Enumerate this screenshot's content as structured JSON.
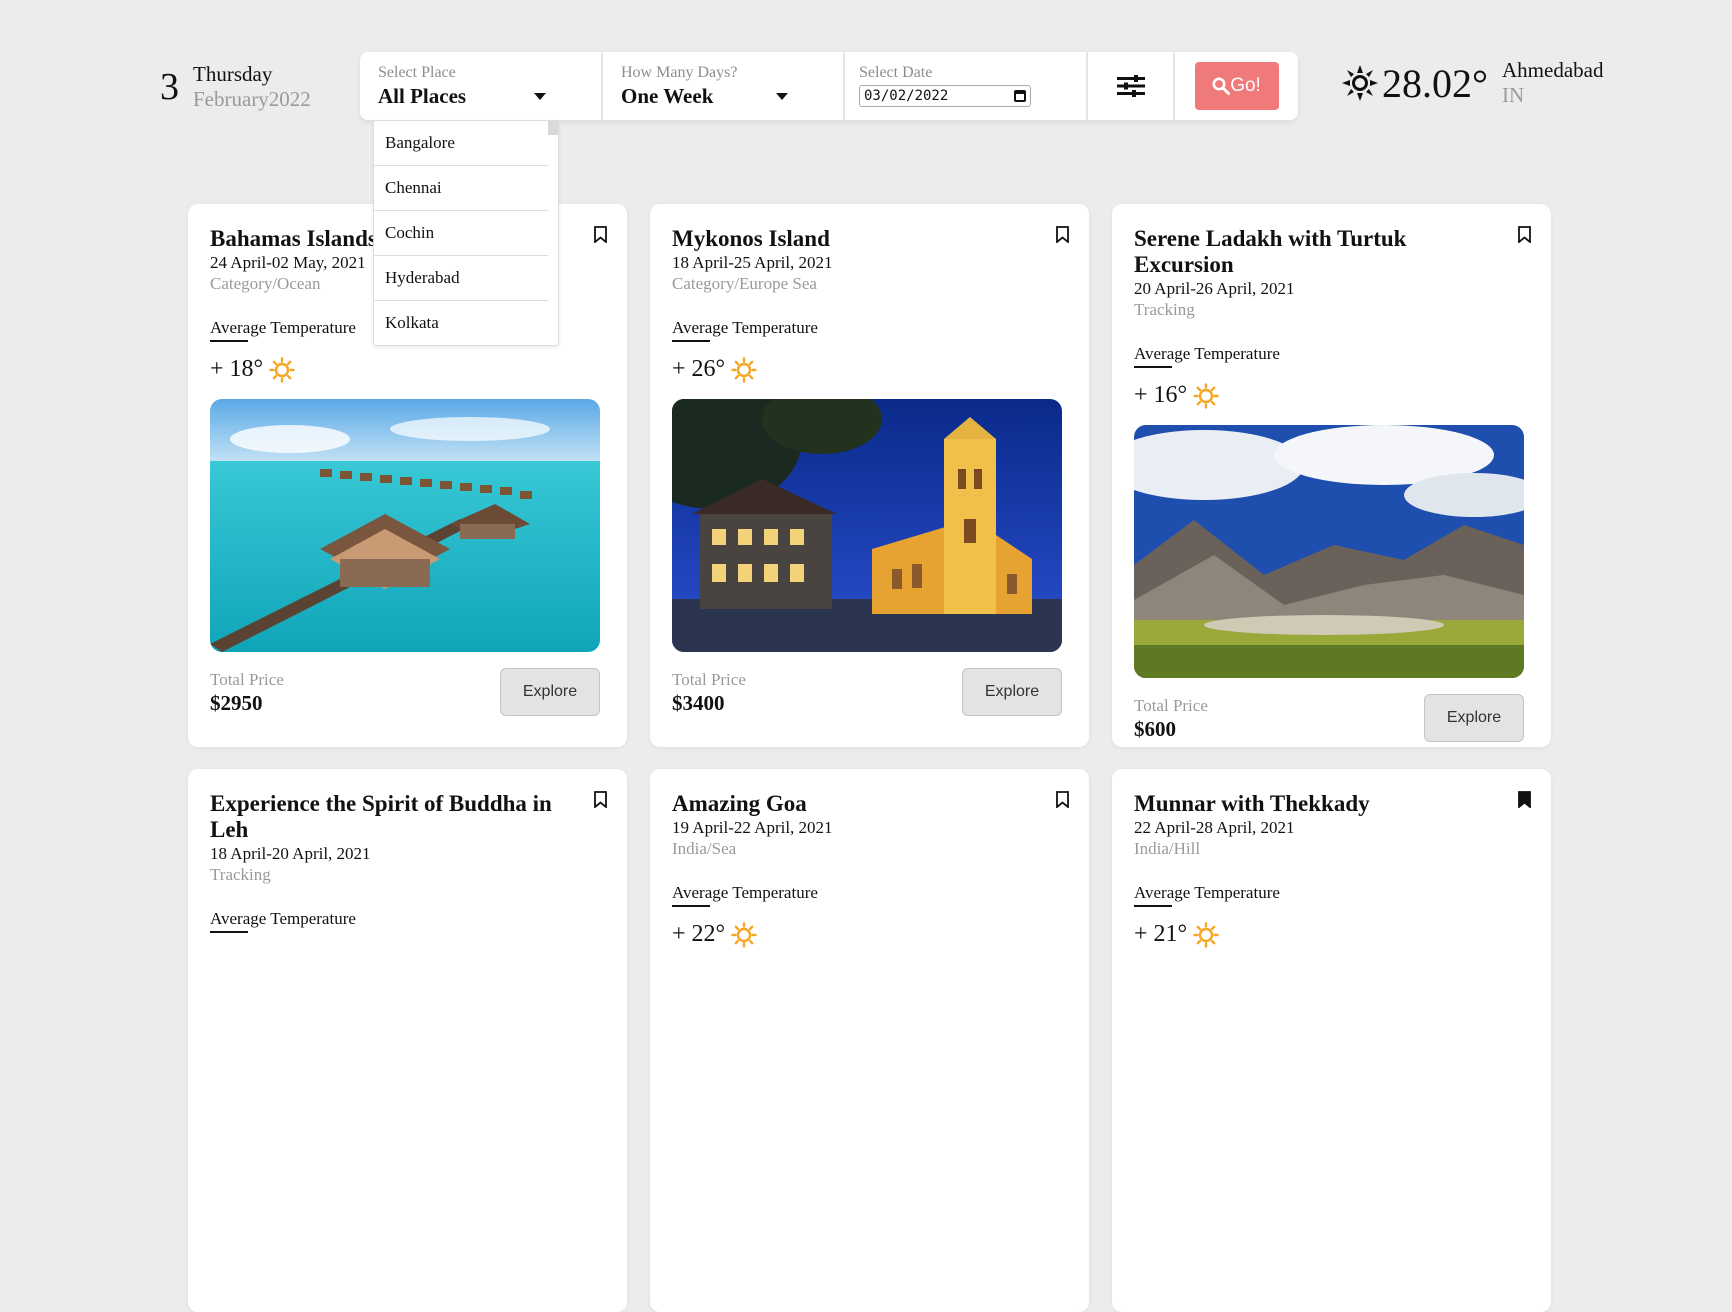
{
  "date": {
    "day": "3",
    "weekday": "Thursday",
    "month_year": "February2022"
  },
  "filters": {
    "place_label": "Select Place",
    "place_value": "All Places",
    "days_label": "How Many Days?",
    "days_value": "One Week",
    "date_label": "Select Date",
    "date_value": "03/02/2022",
    "go_label": "Go!"
  },
  "place_options": [
    "Bangalore",
    "Chennai",
    "Cochin",
    "Hyderabad",
    "Kolkata"
  ],
  "weather": {
    "temp": "28.02°",
    "city": "Ahmedabad",
    "country": "IN"
  },
  "avg_temp_label": "Average Temperature",
  "total_price_label": "Total Price",
  "explore_label": "Explore",
  "cards": [
    {
      "title": "Bahamas Islands",
      "dates": "24 April-02 May, 2021",
      "category": "Category/Ocean",
      "temp": "+ 18°",
      "price": "$2950",
      "bookmarked": false
    },
    {
      "title": "Mykonos Island",
      "dates": "18 April-25 April, 2021",
      "category": "Category/Europe Sea",
      "temp": "+ 26°",
      "price": "$3400",
      "bookmarked": false
    },
    {
      "title": "Serene Ladakh with Turtuk Excursion",
      "dates": "20 April-26 April, 2021",
      "category": "Tracking",
      "temp": "+ 16°",
      "price": "$600",
      "bookmarked": false
    },
    {
      "title": "Experience the Spirit of Buddha in Leh",
      "dates": "18 April-20 April, 2021",
      "category": "Tracking",
      "temp": "",
      "price": "",
      "bookmarked": false
    },
    {
      "title": "Amazing Goa",
      "dates": "19 April-22 April, 2021",
      "category": "India/Sea",
      "temp": "+ 22°",
      "price": "",
      "bookmarked": false
    },
    {
      "title": "Munnar with Thekkady",
      "dates": "22 April-28 April, 2021",
      "category": "India/Hill",
      "temp": "+ 21°",
      "price": "",
      "bookmarked": true
    }
  ],
  "colors": {
    "go_button": "#f07a7a",
    "sun": "#f5a623",
    "background": "#ececec"
  }
}
